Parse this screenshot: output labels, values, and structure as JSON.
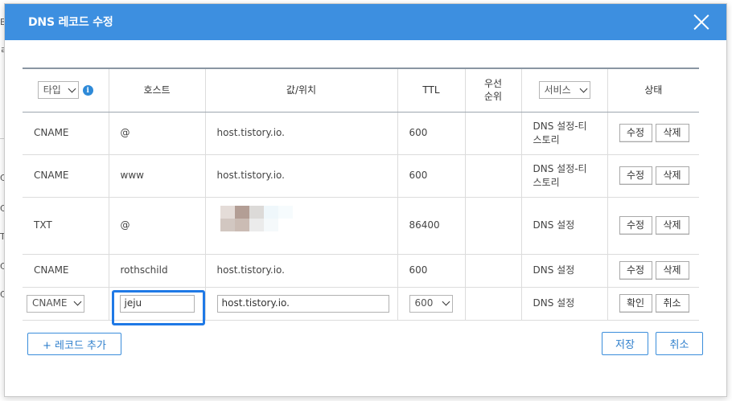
{
  "background": {
    "fragments": [
      "B",
      "ㄹ",
      "C",
      "C",
      "T",
      "C",
      "C"
    ]
  },
  "modal": {
    "title": "DNS 레코드 수정"
  },
  "table": {
    "headers": {
      "type_select": "타입",
      "host": "호스트",
      "value": "값/위치",
      "ttl": "TTL",
      "priority_line1": "우선",
      "priority_line2": "순위",
      "service_select": "서비스",
      "status": "상태"
    },
    "rows": [
      {
        "type": "CNAME",
        "host": "@",
        "value": "host.tistory.io.",
        "ttl": "600",
        "service_line1": "DNS 설정-티",
        "service_line2": "스토리",
        "edit": "수정",
        "delete": "삭제"
      },
      {
        "type": "CNAME",
        "host": "www",
        "value": "host.tistory.io.",
        "ttl": "600",
        "service_line1": "DNS 설정-티",
        "service_line2": "스토리",
        "edit": "수정",
        "delete": "삭제"
      },
      {
        "type": "TXT",
        "host": "@",
        "value": "",
        "ttl": "86400",
        "service_line1": "DNS 설정",
        "service_line2": "",
        "edit": "수정",
        "delete": "삭제"
      },
      {
        "type": "CNAME",
        "host": "rothschild",
        "value": "host.tistory.io.",
        "ttl": "600",
        "service_line1": "DNS 설정",
        "service_line2": "",
        "edit": "수정",
        "delete": "삭제"
      }
    ],
    "edit_row": {
      "type": "CNAME",
      "host": "jeju",
      "value": "host.tistory.io.",
      "ttl": "600",
      "service": "DNS 설정",
      "confirm": "확인",
      "cancel": "취소"
    }
  },
  "footer": {
    "add_record": "+ 레코드 추가",
    "save": "저장",
    "cancel": "취소"
  },
  "colors": {
    "header_bg": "#3d8fe0",
    "accent": "#3a8ddb",
    "highlight": "#1f79e6"
  }
}
